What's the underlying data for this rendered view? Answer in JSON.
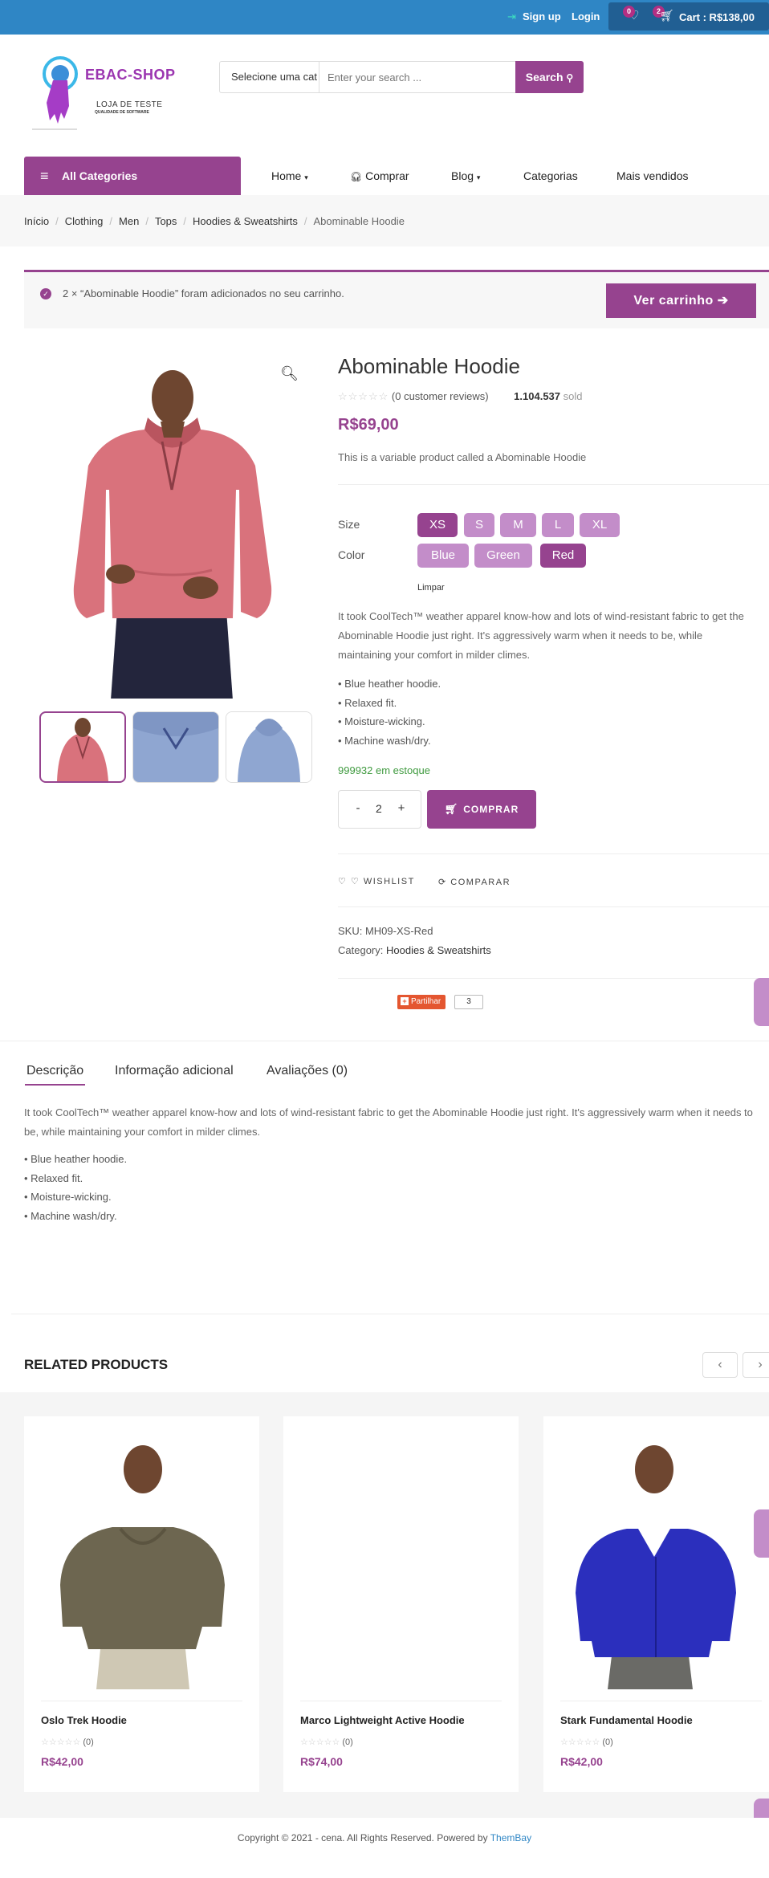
{
  "topbar": {
    "signup": "Sign up",
    "login": "Login",
    "wishlist_count": "0",
    "cart_count": "2",
    "cart_label": "Cart : R$138,00"
  },
  "header": {
    "logo_title": "EBAC-SHOP",
    "logo_sub": "LOJA DE TESTE",
    "logo_tagline": "QUALIDADE DE SOFTWARE",
    "category_select": "Selecione uma cat",
    "search_placeholder": "Enter your search ...",
    "search_button": "Search"
  },
  "nav": {
    "all_categories": "All Categories",
    "items": [
      "Home",
      "Comprar",
      "Blog",
      "Categorias",
      "Mais vendidos"
    ]
  },
  "breadcrumb": [
    "Início",
    "Clothing",
    "Men",
    "Tops",
    "Hoodies & Sweatshirts",
    "Abominable Hoodie"
  ],
  "notice": {
    "message": "2 × “Abominable Hoodie” foram adicionados no seu carrinho.",
    "button": "Ver carrinho"
  },
  "product": {
    "title": "Abominable Hoodie",
    "reviews": "(0 customer reviews)",
    "sold_count": "1.104.537",
    "sold_label": "sold",
    "price": "R$69,00",
    "short_description": "This is a variable product called a Abominable Hoodie",
    "size_label": "Size",
    "sizes": [
      "XS",
      "S",
      "M",
      "L",
      "XL"
    ],
    "selected_size": "XS",
    "color_label": "Color",
    "colors": [
      "Blue",
      "Green",
      "Red"
    ],
    "selected_color": "Red",
    "clear": "Limpar",
    "description": "It took CoolTech™ weather apparel know-how and lots of wind-resistant fabric to get the Abominable Hoodie just right. It's aggressively warm when it needs to be, while maintaining your comfort in milder climes.",
    "bullets": [
      "• Blue heather hoodie.",
      "• Relaxed fit.",
      "• Moisture-wicking.",
      "• Machine wash/dry."
    ],
    "stock": "999932 em estoque",
    "qty_minus": "-",
    "quantity": "2",
    "qty_plus": "+",
    "buy_button": "COMPRAR",
    "wishlist": "WISHLIST",
    "compare": "COMPARAR",
    "sku_label": "SKU:",
    "sku": "MH09-XS-Red",
    "category_label": "Category:",
    "category": "Hoodies & Sweatshirts",
    "share_label": "Partilhar",
    "share_count": "3"
  },
  "tabs": {
    "items": [
      "Descrição",
      "Informação adicional",
      "Avaliações (0)"
    ],
    "active": "Descrição",
    "description": "It took CoolTech™ weather apparel know-how and lots of wind-resistant fabric to get the Abominable Hoodie just right. It's aggressively warm when it needs to be, while maintaining your comfort in milder climes.",
    "bullets": [
      "• Blue heather hoodie.",
      "• Relaxed fit.",
      "• Moisture-wicking.",
      "• Machine wash/dry."
    ]
  },
  "related": {
    "heading": "RELATED PRODUCTS",
    "products": [
      {
        "name": "Oslo Trek Hoodie",
        "reviews": "(0)",
        "price": "R$42,00"
      },
      {
        "name": "Marco Lightweight Active Hoodie",
        "reviews": "(0)",
        "price": "R$74,00"
      },
      {
        "name": "Stark Fundamental Hoodie",
        "reviews": "(0)",
        "price": "R$42,00"
      }
    ]
  },
  "footer": {
    "text": "Copyright © 2021 - cena. All Rights Reserved. Powered by",
    "link": "ThemBay"
  },
  "colors": {
    "topbar": "#2f86c5",
    "accent": "#96438f",
    "accent_light": "#c38dc9",
    "stock": "#3f9a3f"
  }
}
